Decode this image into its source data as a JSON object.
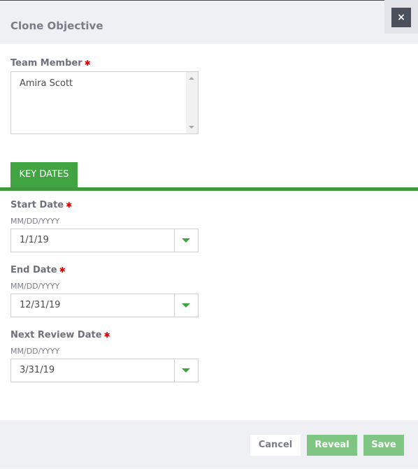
{
  "dialog": {
    "title": "Clone Objective",
    "close_label": "×"
  },
  "team_member": {
    "label": "Team Member",
    "required_mark": "✱",
    "selected": "Amira Scott"
  },
  "tabs": [
    {
      "label": "KEY DATES",
      "active": true
    }
  ],
  "dates": [
    {
      "label": "Start Date",
      "required_mark": "✱",
      "format_hint": "MM/DD/YYYY",
      "value": "1/1/19"
    },
    {
      "label": "End Date",
      "required_mark": "✱",
      "format_hint": "MM/DD/YYYY",
      "value": "12/31/19"
    },
    {
      "label": "Next Review Date",
      "required_mark": "✱",
      "format_hint": "MM/DD/YYYY",
      "value": "3/31/19"
    }
  ],
  "footer": {
    "cancel_label": "Cancel",
    "reveal_label": "Reveal",
    "save_label": "Save"
  },
  "colors": {
    "accent_green": "#42a343",
    "button_green": "#80c683",
    "required_red": "#e00000",
    "header_bg": "#eff0f4"
  }
}
